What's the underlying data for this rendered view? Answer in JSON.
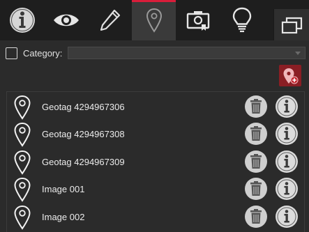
{
  "tabs": [
    {
      "name": "info-icon",
      "active": false
    },
    {
      "name": "eye-icon",
      "active": false
    },
    {
      "name": "pen-icon",
      "active": false
    },
    {
      "name": "map-pin-icon",
      "active": true
    },
    {
      "name": "camera-badge-icon",
      "active": false
    },
    {
      "name": "lightbulb-icon",
      "active": false
    }
  ],
  "panel_button_icon": "window-stack-icon",
  "category": {
    "label": "Category:",
    "checked": false,
    "selected_value": ""
  },
  "add_button_icon": "add-geotag-icon",
  "colors": {
    "accent": "#d91d3a",
    "add_button_bg": "#8a1e24",
    "background": "#2b2b2b"
  },
  "items": [
    {
      "label": "Geotag 4294967306"
    },
    {
      "label": "Geotag 4294967308"
    },
    {
      "label": "Geotag 4294967309"
    },
    {
      "label": "Image 001"
    },
    {
      "label": "Image 002"
    }
  ]
}
